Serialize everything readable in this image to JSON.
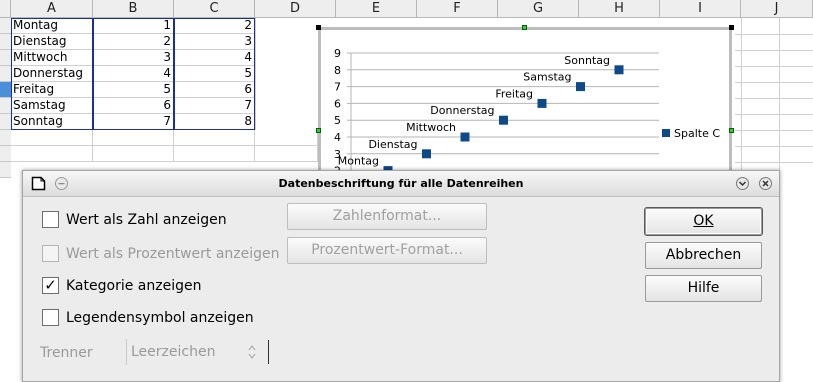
{
  "spreadsheet": {
    "columns": [
      "A",
      "B",
      "C",
      "D",
      "E",
      "F",
      "G",
      "H",
      "I",
      "J"
    ],
    "rows": [
      {
        "a": "Montag",
        "b": "1",
        "c": "2"
      },
      {
        "a": "Dienstag",
        "b": "2",
        "c": "3"
      },
      {
        "a": "Mittwoch",
        "b": "3",
        "c": "4"
      },
      {
        "a": "Donnerstag",
        "b": "4",
        "c": "5"
      },
      {
        "a": "Freitag",
        "b": "5",
        "c": "6"
      },
      {
        "a": "Samstag",
        "b": "6",
        "c": "7"
      },
      {
        "a": "Sonntag",
        "b": "7",
        "c": "8"
      }
    ]
  },
  "chart_data": {
    "type": "scatter",
    "categories": [
      "Montag",
      "Dienstag",
      "Mittwoch",
      "Donnerstag",
      "Freitag",
      "Samstag",
      "Sonntag"
    ],
    "series": [
      {
        "name": "Spalte C",
        "values": [
          2,
          3,
          4,
          5,
          6,
          7,
          8
        ]
      }
    ],
    "y_ticks": [
      "2",
      "3",
      "4",
      "5",
      "6",
      "7",
      "8",
      "9"
    ],
    "legend": "right",
    "marker_color": "#0e4a8a"
  },
  "dialog": {
    "title": "Datenbeschriftung für alle Datenreihen",
    "options": {
      "value_number": {
        "label": "Wert als Zahl anzeigen",
        "checked": false
      },
      "value_percent": {
        "label": "Wert als Prozentwert anzeigen",
        "checked": false,
        "disabled": true
      },
      "category": {
        "label": "Kategorie anzeigen",
        "checked": true
      },
      "legend_symbol": {
        "label": "Legendensymbol anzeigen",
        "checked": false
      }
    },
    "number_format_label": "Zahlenformat...",
    "percent_format_label": "Prozentwert-Format...",
    "separator_label": "Trenner",
    "separator_value": "Leerzeichen",
    "ok_label": "OK",
    "cancel_label": "Abbrechen",
    "help_label": "Hilfe",
    "check_mark": "✓"
  }
}
